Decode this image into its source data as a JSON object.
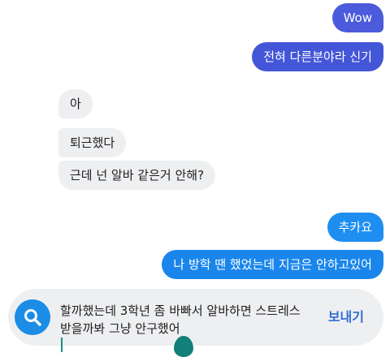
{
  "messages": [
    {
      "id": "b1",
      "direction": "outgoing",
      "text": "Wow"
    },
    {
      "id": "b2",
      "direction": "outgoing",
      "text": "전혀 다른분야라 신기"
    },
    {
      "id": "b3",
      "direction": "incoming",
      "text": "아"
    },
    {
      "id": "b4",
      "direction": "incoming",
      "text": "퇴근했다"
    },
    {
      "id": "b5",
      "direction": "incoming",
      "text": "근데 넌 알바 같은거 안해?"
    },
    {
      "id": "b6",
      "direction": "outgoing",
      "text": "추카요"
    },
    {
      "id": "b7",
      "direction": "outgoing",
      "text": "나 방학 땐 했었는데 지금은 안하고있어"
    }
  ],
  "composer": {
    "line1": "할까했는데 3학년 좀 바빠서 알바하면 스트레스",
    "line2": "받을까봐 그냥 안구했어",
    "send_label": "보내기",
    "search_icon": "search-icon"
  },
  "colors": {
    "outgoing_purple": "#4b5bdc",
    "outgoing_blue": "#1e8ff0",
    "incoming_bg": "#eeeff1",
    "send_text": "#2d6ed3",
    "caret": "#16918c"
  }
}
